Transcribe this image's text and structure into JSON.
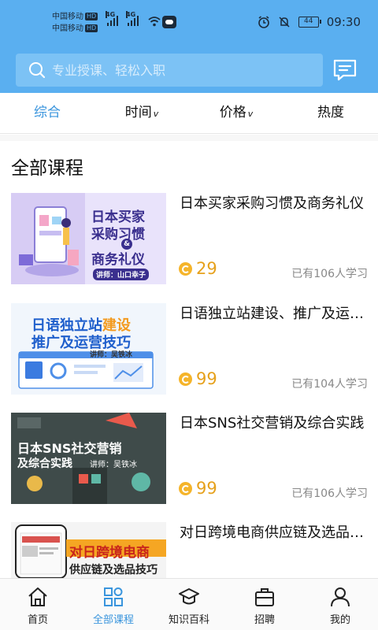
{
  "status_bar": {
    "carrier_1": "中国移动",
    "carrier_2": "中国移动",
    "hd": "HD",
    "net": "4G",
    "battery": "44",
    "time": "09:30"
  },
  "search": {
    "placeholder": "专业授课、轻松入职"
  },
  "tabs": [
    {
      "label": "综合",
      "arrow": ""
    },
    {
      "label": "时间",
      "arrow": "v"
    },
    {
      "label": "价格",
      "arrow": "v"
    },
    {
      "label": "热度",
      "arrow": ""
    }
  ],
  "section_title": "全部课程",
  "courses": [
    {
      "title": "日本买家采购习惯及商务礼仪",
      "price": "29",
      "learners": "已有106人学习",
      "thumb_line1": "日本买家",
      "thumb_line2": "采购习惯",
      "thumb_amp": "&",
      "thumb_line3": "商务礼仪",
      "thumb_teacher": "讲师：山口幸子"
    },
    {
      "title": "日语独立站建设、推广及运营技巧",
      "price": "99",
      "learners": "已有104人学习",
      "thumb_line1a": "日语独立站",
      "thumb_line1b": "建设",
      "thumb_line2": "推广及运营技巧",
      "thumb_teacher": "讲师：吴铁冰"
    },
    {
      "title": "日本SNS社交营销及综合实践",
      "price": "99",
      "learners": "已有106人学习",
      "thumb_line1": "日本SNS社交营销",
      "thumb_line2": "及综合实践",
      "thumb_teacher": "讲师：吴铁冰"
    },
    {
      "title": "对日跨境电商供应链及选品技巧",
      "thumb_line1": "对日跨境电商",
      "thumb_line2": "供应链及选品技巧"
    }
  ],
  "bottom_nav": [
    {
      "label": "首页",
      "icon": "home-icon"
    },
    {
      "label": "全部课程",
      "icon": "grid-icon"
    },
    {
      "label": "知识百科",
      "icon": "graduation-cap-icon"
    },
    {
      "label": "招聘",
      "icon": "briefcase-icon"
    },
    {
      "label": "我的",
      "icon": "user-icon"
    }
  ],
  "colors": {
    "header": "#5aaff0",
    "accent": "#3a95dd",
    "price": "#e6a11c"
  }
}
